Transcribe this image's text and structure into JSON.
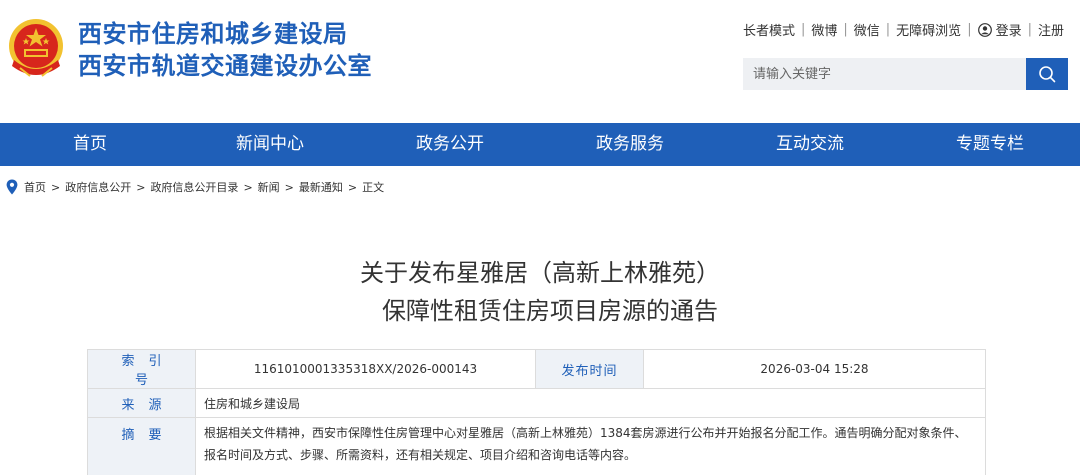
{
  "site": {
    "title_line1": "西安市住房和城乡建设局",
    "title_line2": "西安市轨道交通建设办公室",
    "emblem_icon": "national-emblem-icon"
  },
  "toplinks": {
    "elder_mode": "长者模式",
    "weibo": "微博",
    "wechat": "微信",
    "accessible": "无障碍浏览",
    "login": "登录",
    "register": "注册",
    "user_icon": "user-icon"
  },
  "search": {
    "placeholder": "请输入关键字",
    "icon": "search-icon"
  },
  "nav": {
    "items": [
      "首页",
      "新闻中心",
      "政务公开",
      "政务服务",
      "互动交流",
      "专题专栏"
    ]
  },
  "breadcrumb": {
    "icon": "location-pin-icon",
    "items": [
      "首页",
      "政府信息公开",
      "政府信息公开目录",
      "新闻",
      "最新通知",
      "正文"
    ]
  },
  "article": {
    "title_line1": "关于发布星雅居（高新上林雅苑）",
    "title_line2": "保障性租赁住房项目房源的通告"
  },
  "info": {
    "index_label": "索引号",
    "index_value": "1161010001335318XX/2026-000143",
    "date_label": "发布时间",
    "date_value": "2026-03-04 15:28",
    "source_label": "来源",
    "source_value": "住房和城乡建设局",
    "summary_label": "摘要",
    "summary_value": "根据相关文件精神，西安市保障性住房管理中心对星雅居（高新上林雅苑）1384套房源进行公布并开始报名分配工作。通告明确分配对象条件、报名时间及方式、步骤、所需资料，还有相关规定、项目介绍和咨询电话等内容。"
  },
  "colors": {
    "brand_blue": "#1f5fb8",
    "label_bg": "#eef2f7",
    "emblem_red": "#d7261c",
    "emblem_gold": "#f2c230"
  }
}
